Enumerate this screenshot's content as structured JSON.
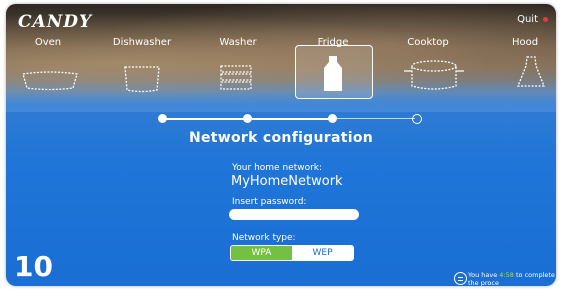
{
  "brand": "CANDY",
  "header": {
    "quit_label": "Quit"
  },
  "appliances": [
    {
      "label": "Oven",
      "icon": "oven-tray-icon"
    },
    {
      "label": "Dishwasher",
      "icon": "dishwasher-pot-icon"
    },
    {
      "label": "Washer",
      "icon": "washer-stack-icon"
    },
    {
      "label": "Fridge",
      "icon": "fridge-bottle-icon",
      "selected": true
    },
    {
      "label": "Cooktop",
      "icon": "cooktop-pot-icon"
    },
    {
      "label": "Hood",
      "icon": "hood-icon"
    }
  ],
  "progress": {
    "total_steps": 4,
    "completed_steps": 3
  },
  "main": {
    "title": "Network configuration",
    "home_network_label": "Your home network:",
    "home_network_value": "MyHomeNetwork",
    "password_label": "Insert password:",
    "password_value": "",
    "network_type_label": "Network type:",
    "network_type_options": [
      "WPA",
      "WEP"
    ],
    "network_type_selected": "WPA"
  },
  "step_number": "10",
  "timer": {
    "prefix": "You have ",
    "time": "4:58",
    "suffix": " to complete the proce"
  },
  "colors": {
    "background_blue": "#1f75d8",
    "selected_green": "#74c043",
    "quit_dot": "#e23b3b"
  }
}
